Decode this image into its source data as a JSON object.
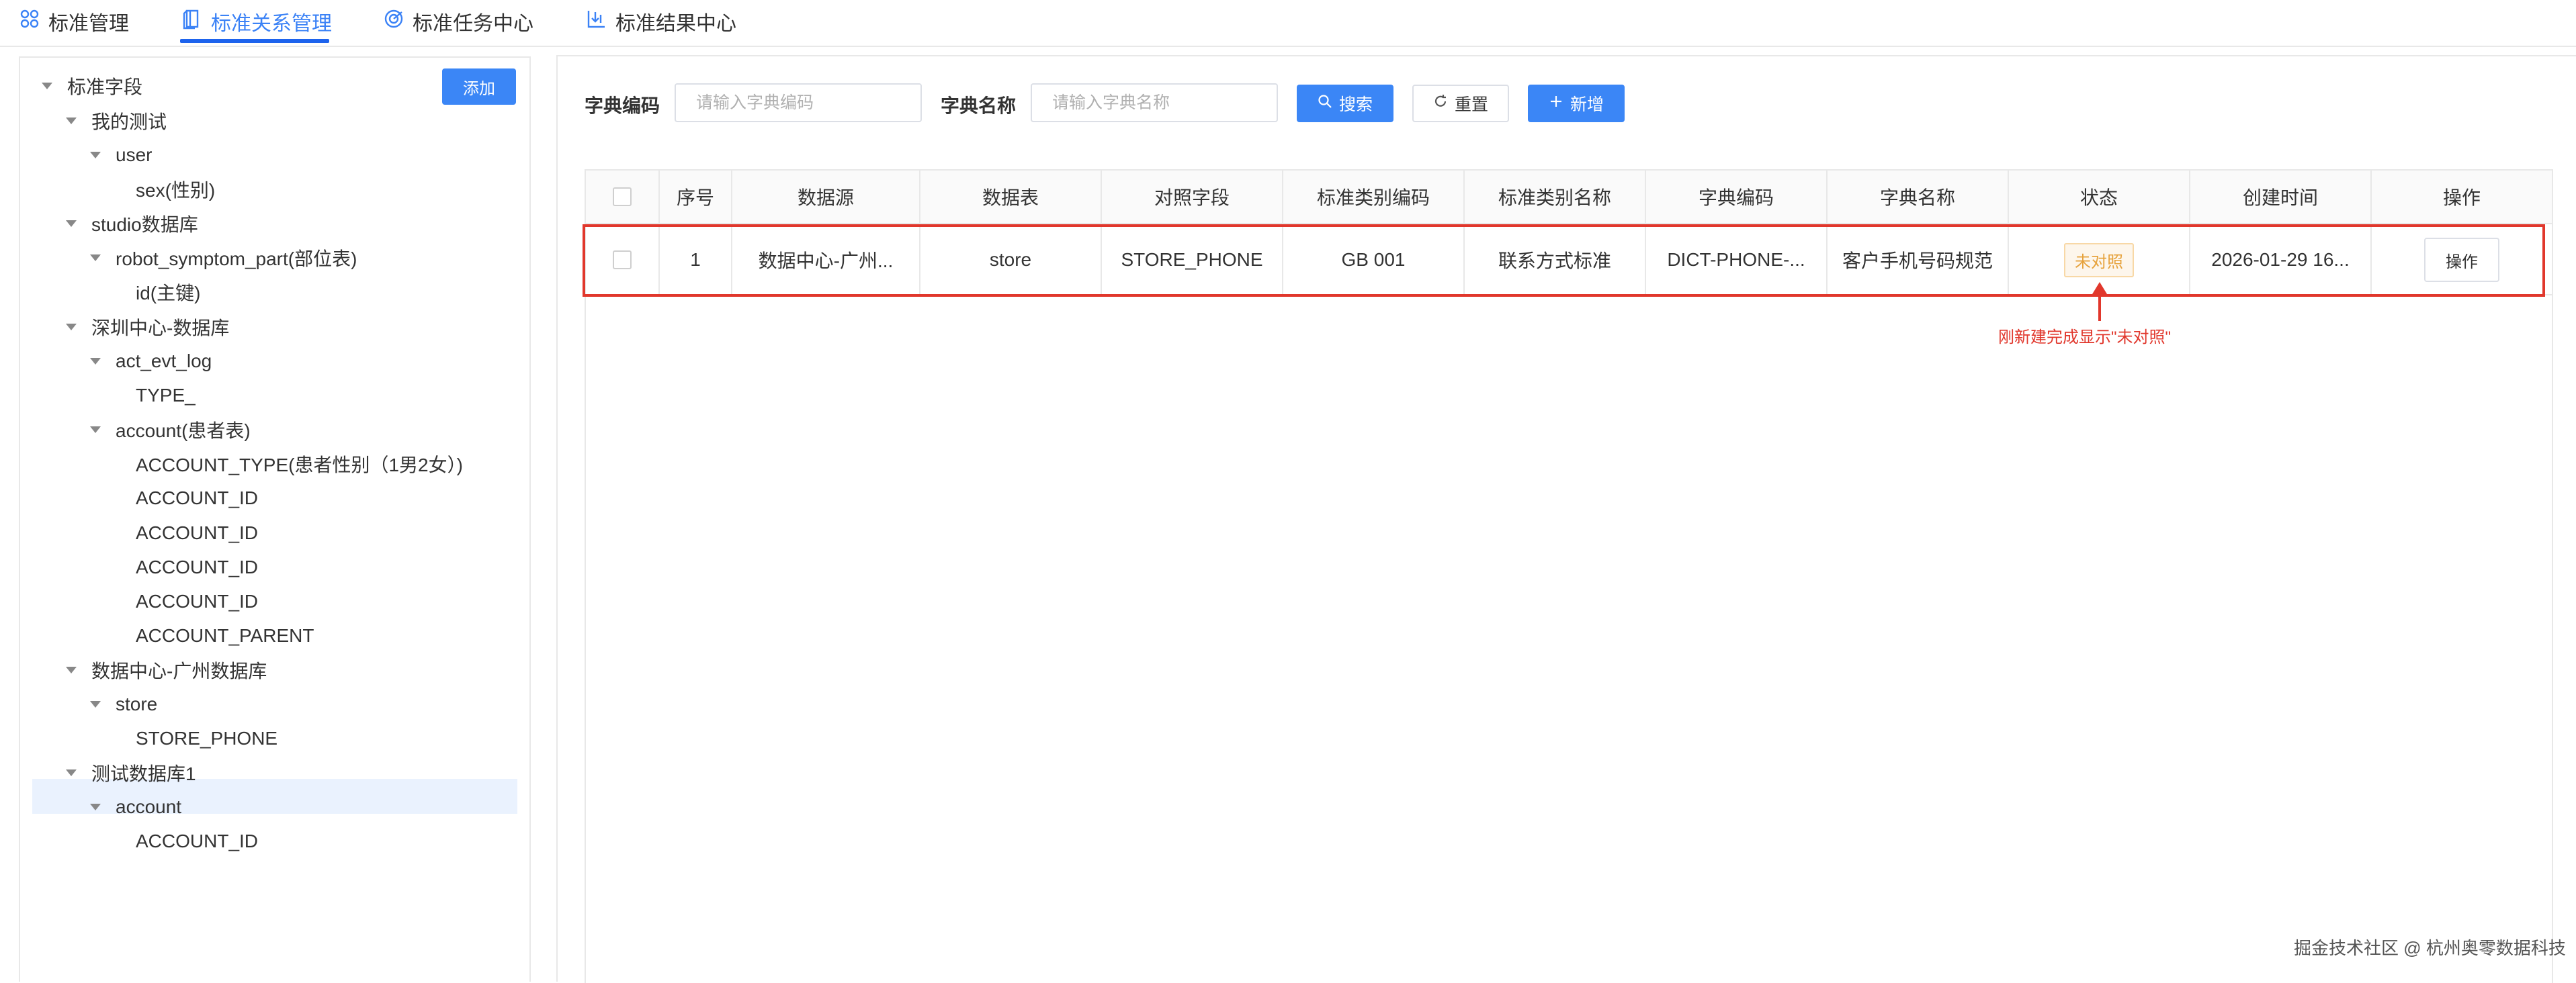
{
  "tabs": [
    {
      "label": "标准管理",
      "icon": "grid-icon"
    },
    {
      "label": "标准关系管理",
      "icon": "book-icon",
      "active": true
    },
    {
      "label": "标准任务中心",
      "icon": "target-icon"
    },
    {
      "label": "标准结果中心",
      "icon": "chart-download-icon"
    }
  ],
  "tree": {
    "add_label": "添加",
    "nodes": [
      {
        "label": "标准字段",
        "level": 0,
        "expanded": true
      },
      {
        "label": "我的测试",
        "level": 1,
        "expanded": true
      },
      {
        "label": "user",
        "level": 2,
        "expanded": true
      },
      {
        "label": "sex(性别)",
        "level": 3
      },
      {
        "label": "studio数据库",
        "level": 1,
        "expanded": true
      },
      {
        "label": "robot_symptom_part(部位表)",
        "level": 2,
        "expanded": true
      },
      {
        "label": "id(主键)",
        "level": 3
      },
      {
        "label": "深圳中心-数据库",
        "level": 1,
        "expanded": true
      },
      {
        "label": "act_evt_log",
        "level": 2,
        "expanded": true
      },
      {
        "label": "TYPE_",
        "level": 3
      },
      {
        "label": "account(患者表)",
        "level": 2,
        "expanded": true
      },
      {
        "label": "ACCOUNT_TYPE(患者性别（1男2女）)",
        "level": 3
      },
      {
        "label": "ACCOUNT_ID",
        "level": 3
      },
      {
        "label": "ACCOUNT_ID",
        "level": 3
      },
      {
        "label": "ACCOUNT_ID",
        "level": 3
      },
      {
        "label": "ACCOUNT_ID",
        "level": 3
      },
      {
        "label": "ACCOUNT_PARENT",
        "level": 3
      },
      {
        "label": "数据中心-广州数据库",
        "level": 1,
        "expanded": true
      },
      {
        "label": "store",
        "level": 2,
        "expanded": true
      },
      {
        "label": "STORE_PHONE",
        "level": 3,
        "selected": true
      },
      {
        "label": "测试数据库1",
        "level": 1,
        "expanded": true
      },
      {
        "label": "account",
        "level": 2,
        "expanded": true
      },
      {
        "label": "ACCOUNT_ID",
        "level": 3
      }
    ]
  },
  "filters": {
    "code_label": "字典编码",
    "code_placeholder": "请输入字典编码",
    "name_label": "字典名称",
    "name_placeholder": "请输入字典名称",
    "search_label": "搜索",
    "reset_label": "重置",
    "add_label": "新增"
  },
  "table": {
    "columns": [
      "序号",
      "数据源",
      "数据表",
      "对照字段",
      "标准类别编码",
      "标准类别名称",
      "字典编码",
      "字典名称",
      "状态",
      "创建时间",
      "操作"
    ],
    "rows": [
      {
        "index": "1",
        "source": "数据中心-广州...",
        "table": "store",
        "field": "STORE_PHONE",
        "category_code": "GB 001",
        "category_name": "联系方式标准",
        "dict_code": "DICT-PHONE-...",
        "dict_name": "客户手机号码规范",
        "status": "未对照",
        "created": "2026-01-29 16...",
        "action": "操作"
      }
    ]
  },
  "annotation": "刚新建完成显示\"未对照\"",
  "watermark": "掘金技术社区 @ 杭州奥零数据科技",
  "colors": {
    "primary": "#3b86f6",
    "highlight": "#e1372c",
    "status_warning": "#e6a23c"
  }
}
